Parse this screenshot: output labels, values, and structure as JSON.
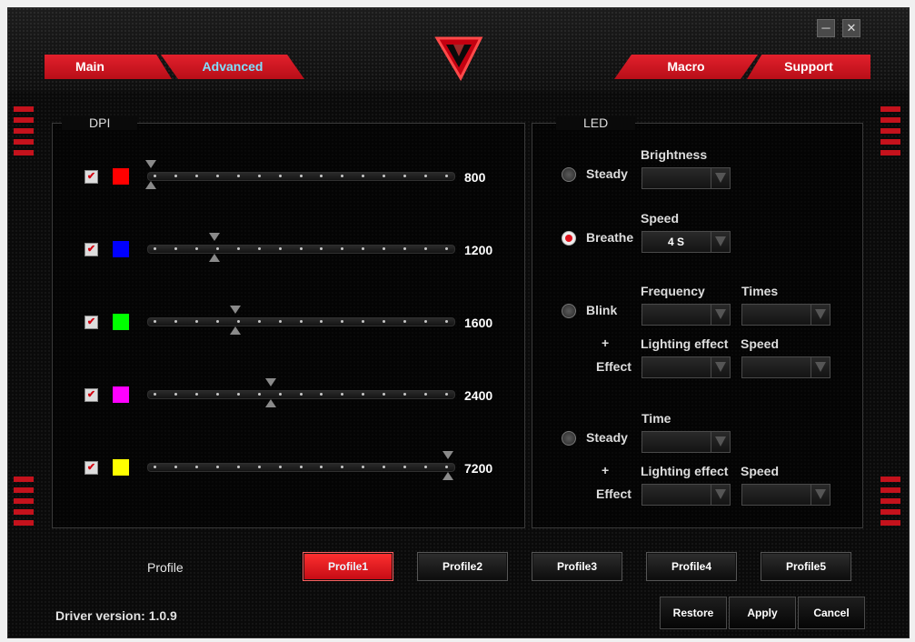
{
  "window": {
    "minimize_icon": "minimize-icon",
    "close_icon": "close-icon"
  },
  "tabs": [
    {
      "label": "Main",
      "active": false
    },
    {
      "label": "Advanced",
      "active": true
    },
    {
      "label": "Macro",
      "active": false
    },
    {
      "label": "Support",
      "active": false
    }
  ],
  "logo": "V",
  "dpi": {
    "legend": "DPI",
    "levels": [
      {
        "enabled": true,
        "color": "#ff0000",
        "value": "800",
        "position": 0.0
      },
      {
        "enabled": true,
        "color": "#0000ff",
        "value": "1200",
        "position": 0.2143
      },
      {
        "enabled": true,
        "color": "#00ff00",
        "value": "1600",
        "position": 0.2857
      },
      {
        "enabled": true,
        "color": "#ff00ff",
        "value": "2400",
        "position": 0.4048
      },
      {
        "enabled": true,
        "color": "#ffff00",
        "value": "7200",
        "position": 1.0
      }
    ]
  },
  "led": {
    "legend": "LED",
    "steady": {
      "label": "Steady",
      "selected": false,
      "brightness_label": "Brightness",
      "brightness_value": ""
    },
    "breathe": {
      "label": "Breathe",
      "selected": true,
      "speed_label": "Speed",
      "speed_value": "4 S"
    },
    "blink": {
      "label": "Blink",
      "selected": false,
      "frequency_label": "Frequency",
      "frequency_value": "",
      "times_label": "Times",
      "times_value": "",
      "plus": "+",
      "effect_label": "Effect",
      "lighting_effect_label": "Lighting effect",
      "lighting_effect_value": "",
      "speed_label": "Speed",
      "speed_value": ""
    },
    "steady_effect": {
      "label": "Steady",
      "selected": false,
      "time_label": "Time",
      "time_value": "",
      "plus": "+",
      "effect_label": "Effect",
      "lighting_effect_label": "Lighting effect",
      "lighting_effect_value": "",
      "speed_label": "Speed",
      "speed_value": ""
    }
  },
  "profile": {
    "label": "Profile",
    "buttons": [
      "Profile1",
      "Profile2",
      "Profile3",
      "Profile4",
      "Profile5"
    ],
    "active_index": 0
  },
  "footer": {
    "driver_version": "Driver version:  1.0.9",
    "restore": "Restore",
    "apply": "Apply",
    "cancel": "Cancel"
  },
  "colors": {
    "accent": "#e2202c",
    "active_tab_text": "#7fe0ff"
  }
}
